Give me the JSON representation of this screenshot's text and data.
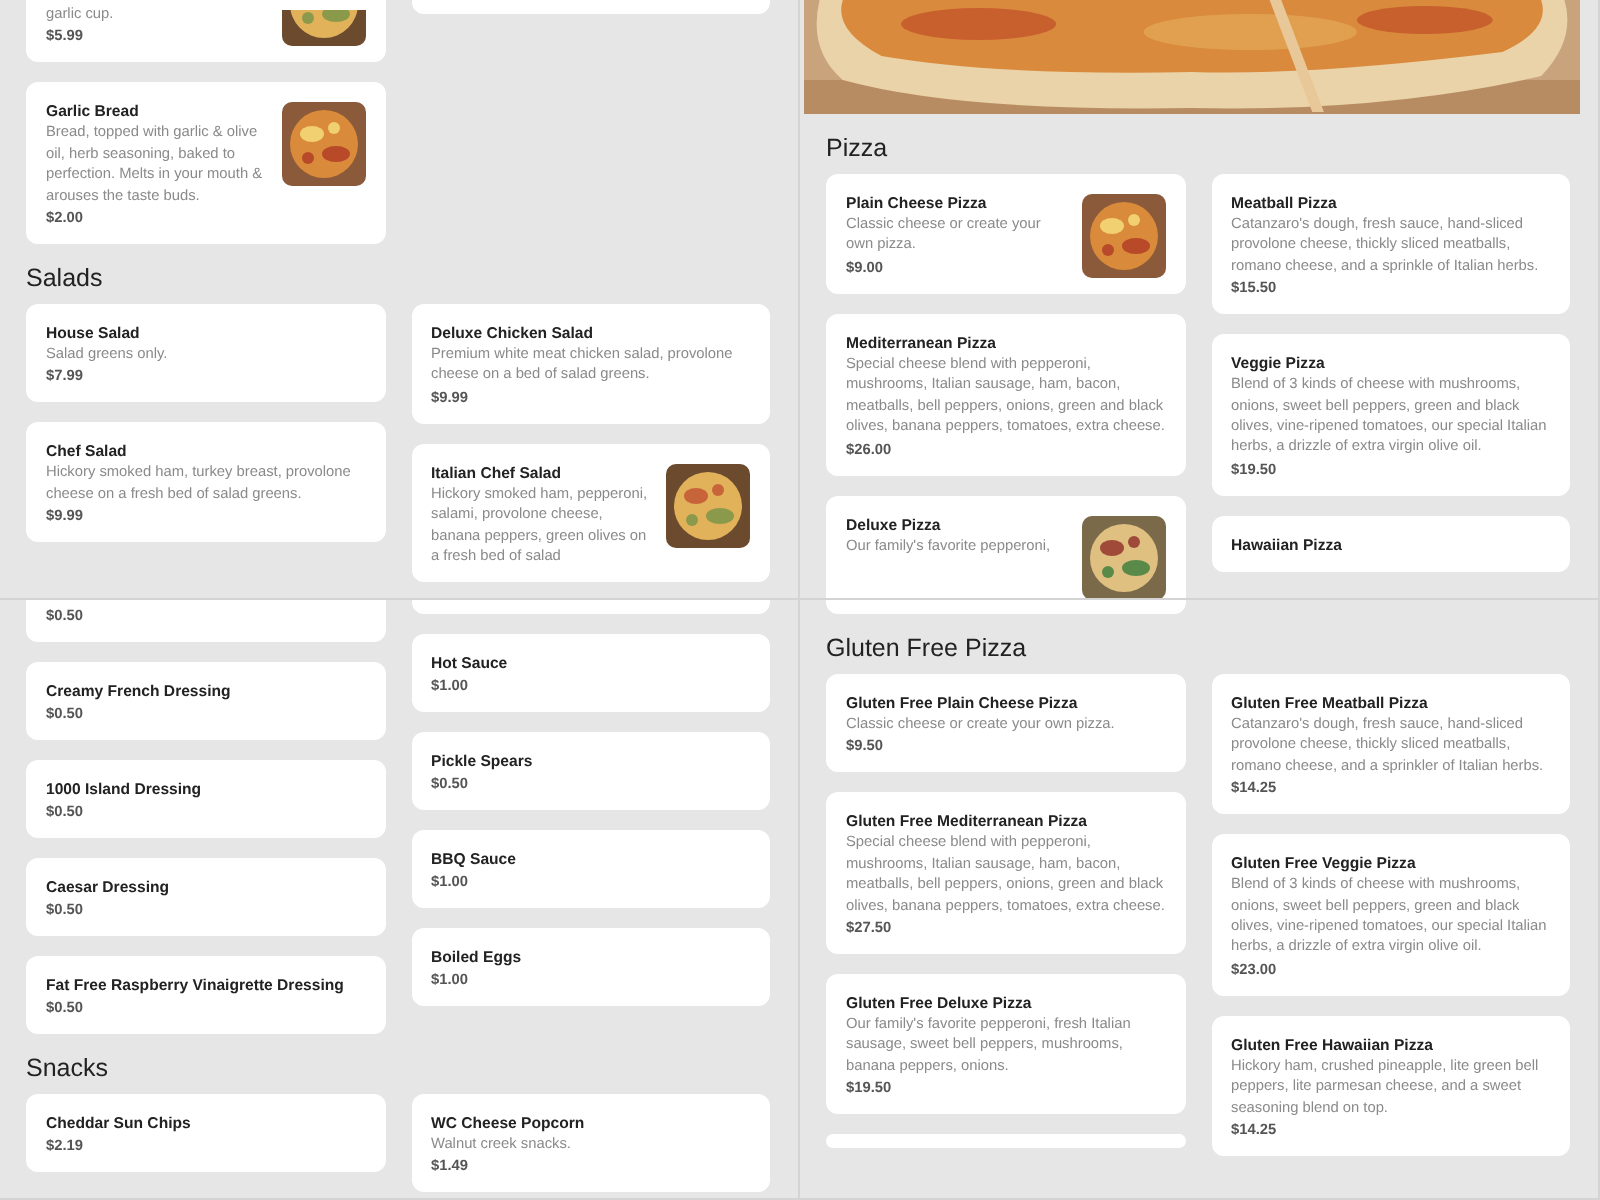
{
  "panels": [
    {
      "sections": [
        {
          "continued": true,
          "columns": [
            [
              {
                "description": "garlic cup.",
                "price": "$5.99"
              },
              {
                "name": "Garlic Bread",
                "description": "Bread, topped with garlic & olive oil, herb seasoning, baked to perfection. Melts in your mouth & arouses the taste buds.",
                "price": "$2.00"
              }
            ],
            [
              {
                "kind": "plain"
              }
            ]
          ]
        },
        {
          "continued": false,
          "title": "Salads",
          "columns": [
            [
              {
                "kind": "plain",
                "name": "House Salad",
                "description": "Salad greens only.",
                "price": "$7.99"
              },
              {
                "kind": "plain",
                "name": "Chef Salad",
                "description": "Hickory smoked ham, turkey breast, provolone cheese on a fresh bed of salad greens.",
                "price": "$9.99"
              }
            ],
            [
              {
                "kind": "plain",
                "name": "Deluxe Chicken Salad",
                "description": "Premium white meat chicken salad, provolone cheese on a bed of salad greens.",
                "price": "$9.99"
              },
              {
                "name": "Italian Chef Salad",
                "description": "Hickory smoked ham, pepperoni, salami, provolone cheese, banana peppers, green olives on a fresh bed of salad"
              }
            ]
          ]
        }
      ]
    },
    {
      "hero": {
        "kind": "picture"
      },
      "sections": [
        {
          "continued": false,
          "title": "Pizza",
          "columns": [
            [
              {
                "name": "Plain Cheese Pizza",
                "description": "Classic cheese or create your own pizza.",
                "price": "$9.00"
              },
              {
                "kind": "plain",
                "name": "Mediterranean Pizza",
                "description": "Special cheese blend with pepperoni, mushrooms, Italian sausage, ham, bacon, meatballs, bell peppers, onions, green and black olives, banana peppers, tomatoes, extra cheese.",
                "price": "$26.00"
              },
              {
                "name": "Deluxe Pizza",
                "description": "Our family's favorite pepperoni,"
              }
            ],
            [
              {
                "kind": "plain",
                "name": "Meatball Pizza",
                "description": "Catanzaro's dough, fresh sauce, hand-sliced provolone cheese, thickly sliced meatballs, romano cheese, and a sprinkle of Italian herbs.",
                "price": "$15.50"
              },
              {
                "kind": "plain",
                "name": "Veggie Pizza",
                "description": "Blend of 3 kinds of cheese with mushrooms, onions, sweet bell peppers, green and black olives, vine-ripened tomatoes, our special Italian herbs, a drizzle of extra virgin olive oil.",
                "price": "$19.50"
              },
              {
                "kind": "plain",
                "name": "Hawaiian Pizza"
              }
            ]
          ]
        }
      ]
    },
    {
      "sections": [
        {
          "continued": true,
          "columns": [
            [
              {
                "kind": "plain",
                "price": "$0.50"
              },
              {
                "kind": "plain",
                "name": "Creamy French Dressing",
                "price": "$0.50"
              },
              {
                "kind": "plain",
                "name": "1000 Island Dressing",
                "price": "$0.50"
              },
              {
                "kind": "plain",
                "name": "Caesar Dressing",
                "price": "$0.50"
              },
              {
                "kind": "plain",
                "name": "Fat Free Raspberry Vinaigrette Dressing",
                "price": "$0.50"
              }
            ],
            [
              {
                "kind": "plain"
              },
              {
                "kind": "plain",
                "name": "Hot Sauce",
                "price": "$1.00"
              },
              {
                "kind": "plain",
                "name": "Pickle Spears",
                "price": "$0.50"
              },
              {
                "kind": "plain",
                "name": "BBQ Sauce",
                "price": "$1.00"
              },
              {
                "kind": "plain",
                "name": "Boiled Eggs",
                "price": "$1.00"
              }
            ]
          ]
        },
        {
          "continued": false,
          "title": "Snacks",
          "columns": [
            [
              {
                "kind": "plain",
                "name": "Cheddar Sun Chips",
                "price": "$2.19"
              }
            ],
            [
              {
                "kind": "plain",
                "name": "WC Cheese Popcorn",
                "description": "Walnut creek snacks.",
                "price": "$1.49"
              }
            ]
          ]
        }
      ]
    },
    {
      "sections": [
        {
          "continued": true,
          "columns": [
            [
              {
                "kind": "plain"
              }
            ],
            []
          ]
        },
        {
          "continued": false,
          "title": "Gluten Free Pizza",
          "columns": [
            [
              {
                "kind": "plain",
                "name": "Gluten Free Plain Cheese Pizza",
                "description": "Classic cheese or create your own pizza.",
                "price": "$9.50"
              },
              {
                "kind": "plain",
                "name": "Gluten Free Mediterranean Pizza",
                "description": "Special cheese blend with pepperoni, mushrooms, Italian sausage, ham, bacon, meatballs, bell peppers, onions, green and black olives, banana peppers, tomatoes, extra cheese.",
                "price": "$27.50"
              },
              {
                "kind": "plain",
                "name": "Gluten Free Deluxe Pizza",
                "description": "Our family's favorite pepperoni, fresh Italian sausage, sweet bell peppers, mushrooms, banana peppers, onions.",
                "price": "$19.50"
              },
              {
                "kind": "plain"
              }
            ],
            [
              {
                "kind": "plain",
                "name": "Gluten Free Meatball Pizza",
                "description": "Catanzaro's dough, fresh sauce, hand-sliced provolone cheese, thickly sliced meatballs, romano cheese, and a sprinkler of Italian herbs.",
                "price": "$14.25"
              },
              {
                "kind": "plain",
                "name": "Gluten Free Veggie Pizza",
                "description": "Blend of 3 kinds of cheese with mushrooms, onions, sweet bell peppers, green and black olives, vine-ripened tomatoes, our special Italian herbs, a drizzle of extra virgin olive oil.",
                "price": "$23.00"
              },
              {
                "kind": "plain",
                "name": "Gluten Free Hawaiian Pizza",
                "description": "Hickory ham, crushed pineapple, lite green bell peppers, lite parmesan cheese, and a sweet seasoning blend on top.",
                "price": "$14.25"
              }
            ]
          ]
        }
      ]
    }
  ]
}
